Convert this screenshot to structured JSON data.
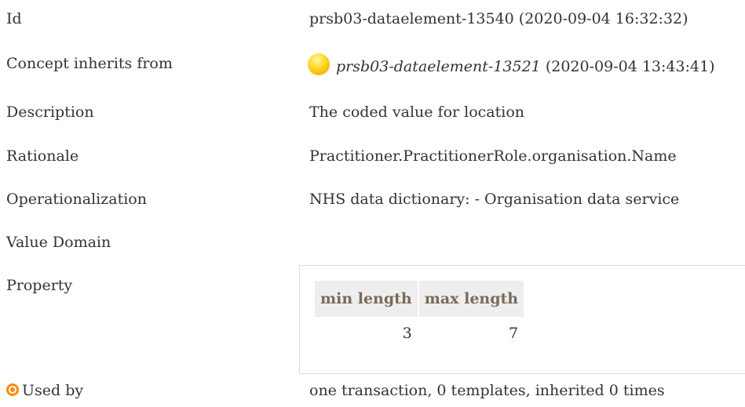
{
  "rows": {
    "id": {
      "label": "Id",
      "value": "prsb03-dataelement-13540 (2020-09-04 16:32:32)"
    },
    "inherits": {
      "label": "Concept inherits from",
      "link": "prsb03-dataelement-13521",
      "date": "(2020-09-04 13:43:41)"
    },
    "description": {
      "label": "Description",
      "value": "The coded value for location"
    },
    "rationale": {
      "label": "Rationale",
      "value": "Practitioner.PractitionerRole.organisation.Name"
    },
    "operationalization": {
      "label": "Operationalization",
      "value": "NHS data dictionary: - Organisation data service"
    },
    "value_domain": {
      "label": "Value Domain"
    },
    "property": {
      "label": "Property",
      "headers": [
        "min length",
        "max length"
      ],
      "values": [
        "3",
        "7"
      ]
    },
    "used_by": {
      "label": "Used by",
      "value": "one transaction, 0 templates, inherited 0 times"
    }
  },
  "icons": {
    "orb": "status-orb-icon",
    "target": "target-icon"
  },
  "colors": {
    "orb": "#f5b800",
    "target": "#ff8a00",
    "header_bg": "#eeeeee",
    "header_text": "#7a6a5a"
  }
}
